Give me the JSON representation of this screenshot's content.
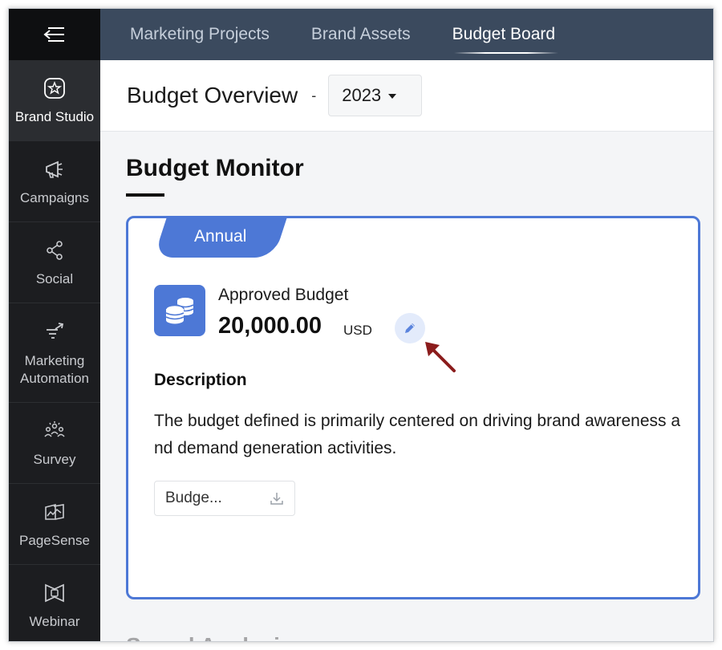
{
  "sidebar": {
    "items": [
      {
        "label": "Brand Studio",
        "icon": "star-burst-icon",
        "active": true
      },
      {
        "label": "Campaigns",
        "icon": "megaphone-icon",
        "active": false
      },
      {
        "label": "Social",
        "icon": "share-nodes-icon",
        "active": false
      },
      {
        "label": "Marketing Automation",
        "icon": "funnel-arrow-icon",
        "active": false
      },
      {
        "label": "Survey",
        "icon": "survey-people-icon",
        "active": false
      },
      {
        "label": "PageSense",
        "icon": "page-sense-icon",
        "active": false
      },
      {
        "label": "Webinar",
        "icon": "webinar-icon",
        "active": false
      }
    ]
  },
  "topnav": {
    "tabs": [
      {
        "label": "Marketing Projects",
        "active": false
      },
      {
        "label": "Brand Assets",
        "active": false
      },
      {
        "label": "Budget Board",
        "active": true
      }
    ]
  },
  "header": {
    "title": "Budget Overview",
    "separator": "-",
    "year": "2023"
  },
  "main": {
    "section_title": "Budget Monitor",
    "card": {
      "badge": "Annual",
      "approved_label": "Approved Budget",
      "amount": "20,000.00",
      "currency": "USD",
      "description_heading": "Description",
      "description_text": "The budget defined is primarily centered on driving brand awareness and demand generation activities.",
      "file_name": "Budge..."
    },
    "next_section_title": "Spend Analysis"
  },
  "colors": {
    "accent": "#4d78d6",
    "nav_bg": "#3b4a5e",
    "sidebar_bg": "#1c1d20",
    "arrow": "#8b1c1c"
  }
}
